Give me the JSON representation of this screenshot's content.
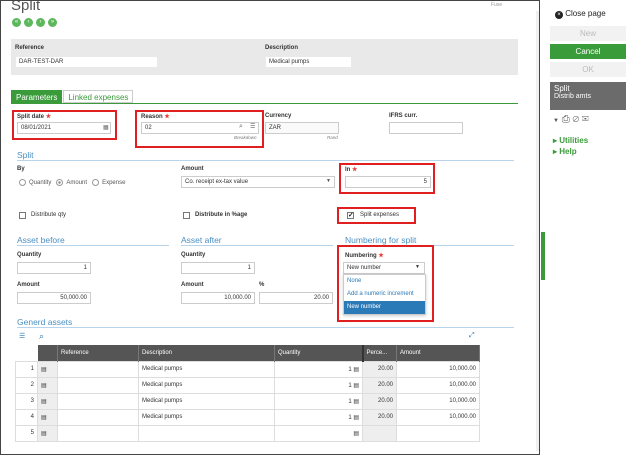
{
  "title": "Split",
  "header": {
    "reference_label": "Reference",
    "reference_value": "DAR-TEST-DAR",
    "description_label": "Description",
    "description_value": "Medical pumps"
  },
  "tabs": [
    {
      "label": "Parameters"
    },
    {
      "label": "Linked expenses"
    }
  ],
  "fields": {
    "split_date_label": "Split date",
    "split_date_value": "08/01/2021",
    "reason_label": "Reason",
    "reason_value": "02",
    "reason_sub": "Breakdown",
    "currency_label": "Currency",
    "currency_value": "ZAR",
    "currency_sub": "Rand",
    "ifrs_label": "IFRS curr."
  },
  "split_section": {
    "title": "Split",
    "by_label": "By",
    "by_options": [
      "Quantity",
      "Amount",
      "Expense"
    ],
    "by_selected": "Amount",
    "amount_label": "Amount",
    "amount_value": "Co. receipt ex-tax value",
    "in_label": "In",
    "in_value": "5",
    "distribute_qty": "Distribute qty",
    "distribute_pct": "Distribute in %age",
    "split_expenses": "Split expenses"
  },
  "asset_before": {
    "title": "Asset before",
    "quantity_label": "Quantity",
    "quantity_value": "1",
    "amount_label": "Amount",
    "amount_value": "50,000.00"
  },
  "asset_after": {
    "title": "Asset after",
    "quantity_label": "Quantity",
    "quantity_value": "1",
    "amount_label": "Amount",
    "amount_value": "10,000.00",
    "pct_label": "%",
    "pct_value": "20.00"
  },
  "numbering": {
    "title": "Numbering for split",
    "label": "Numbering",
    "value": "New number",
    "options": [
      "None",
      "Add a numeric increment",
      "New number"
    ]
  },
  "generated": {
    "title": "Generd assets",
    "columns": [
      "Reference",
      "Description",
      "Quantity",
      "Perce...",
      "Amount"
    ],
    "rows": [
      {
        "n": "1",
        "description": "Medical pumps",
        "quantity": "1",
        "pct": "20.00",
        "amount": "10,000.00"
      },
      {
        "n": "2",
        "description": "Medical pumps",
        "quantity": "1",
        "pct": "20.00",
        "amount": "10,000.00"
      },
      {
        "n": "3",
        "description": "Medical pumps",
        "quantity": "1",
        "pct": "20.00",
        "amount": "10,000.00"
      },
      {
        "n": "4",
        "description": "Medical pumps",
        "quantity": "1",
        "pct": "20.00",
        "amount": "10,000.00"
      },
      {
        "n": "5",
        "description": "",
        "quantity": "",
        "pct": "",
        "amount": ""
      }
    ]
  },
  "sidebar": {
    "close": "Close page",
    "new": "New",
    "cancel": "Cancel",
    "ok": "OK",
    "func_title": "Split",
    "func_sub": "Distrib amts",
    "utilities": "Utilities",
    "help": "Help"
  },
  "colors": {
    "green": "#3a9b3a",
    "blue": "#2a7ab8",
    "red": "#e02020"
  }
}
